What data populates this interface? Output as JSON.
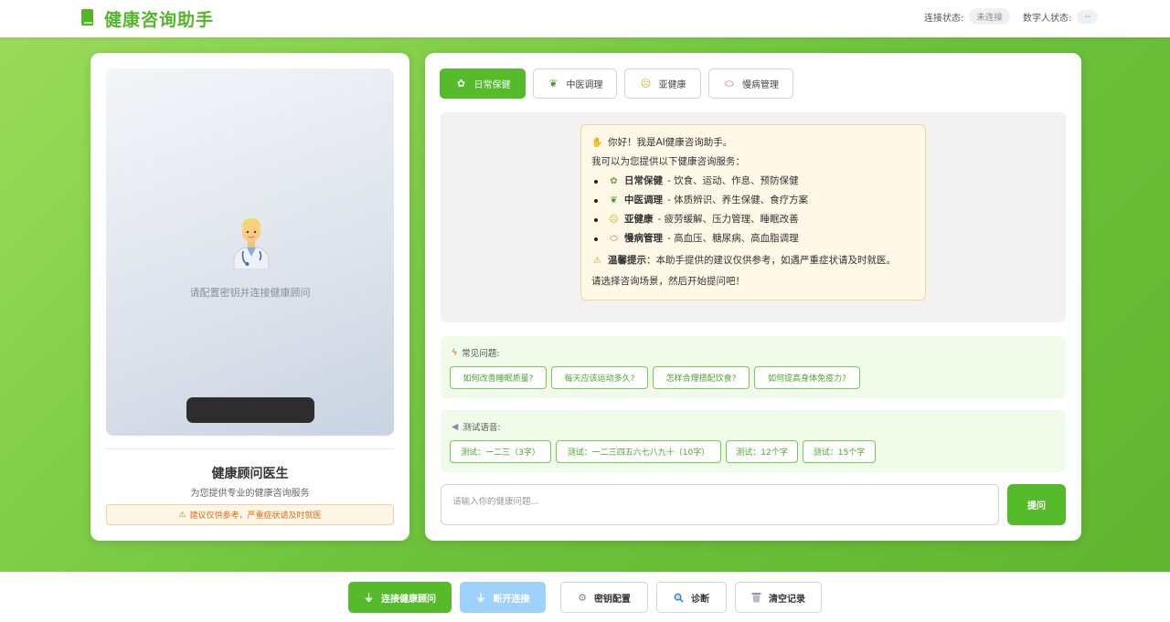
{
  "header": {
    "title": "健康咨询助手",
    "connection_label": "连接状态:",
    "connection_value": "未连接",
    "avatar_status_label": "数字人状态:",
    "avatar_status_value": "--"
  },
  "avatar_panel": {
    "hint": "请配置密钥并连接健康顾问",
    "doctor_name": "健康顾问医生",
    "doctor_desc": "为您提供专业的健康咨询服务",
    "warning": "建议仅供参考，严重症状请及时就医"
  },
  "tabs": [
    {
      "label": "日常保健",
      "icon": "sprout-icon",
      "active": true
    },
    {
      "label": "中医调理",
      "icon": "leaf-icon",
      "active": false
    },
    {
      "label": "亚健康",
      "icon": "tired-face-icon",
      "active": false
    },
    {
      "label": "慢病管理",
      "icon": "pill-icon",
      "active": false
    }
  ],
  "welcome": {
    "greeting": "你好！我是AI健康咨询助手。",
    "intro": "我可以为您提供以下健康咨询服务：",
    "items": [
      {
        "title": "日常保健",
        "desc": " - 饮食、运动、作息、预防保健"
      },
      {
        "title": "中医调理",
        "desc": " - 体质辨识、养生保健、食疗方案"
      },
      {
        "title": "亚健康",
        "desc": " - 疲劳缓解、压力管理、睡眠改善"
      },
      {
        "title": "慢病管理",
        "desc": " - 高血压、糖尿病、高血脂调理"
      }
    ],
    "tip_title": "温馨提示",
    "tip_text": "：本助手提供的建议仅供参考，如遇严重症状请及时就医。",
    "closing": "请选择咨询场景，然后开始提问吧！"
  },
  "faq": {
    "title": "常见问题:",
    "questions": [
      "如何改善睡眠质量?",
      "每天应该运动多久?",
      "怎样合理搭配饮食?",
      "如何提高身体免疫力?"
    ]
  },
  "voice_test": {
    "title": "测试语音:",
    "items": [
      "测试：一二三（3字）",
      "测试：一二三四五六七八九十（10字）",
      "测试：12个字",
      "测试：15个字"
    ]
  },
  "input": {
    "placeholder": "请输入你的健康问题...",
    "submit_label": "提问"
  },
  "footer": {
    "connect": "连接健康顾问",
    "disconnect": "断开连接",
    "key_config": "密钥配置",
    "diagnose": "诊断",
    "clear": "清空记录"
  },
  "colors": {
    "accent": "#55bb2b",
    "disabled_blue": "#9fd2fb",
    "warning": "#e06c1a"
  }
}
